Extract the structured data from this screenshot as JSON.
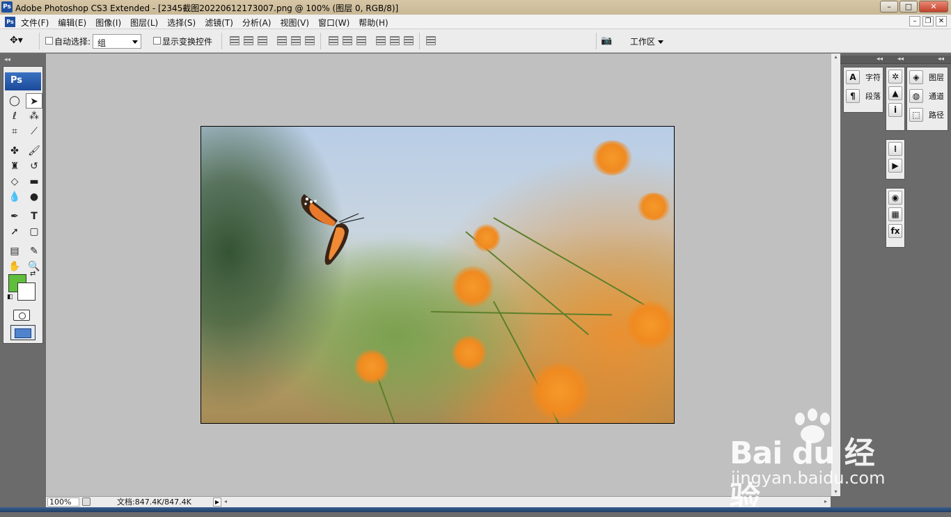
{
  "window": {
    "app_icon": "Ps",
    "title": "Adobe Photoshop CS3 Extended - [2345截图20220612173007.png @ 100% (图层 0, RGB/8)]",
    "controls": {
      "minimize": "–",
      "maximize": "□",
      "close": "✕"
    }
  },
  "menubar": {
    "items": [
      "文件(F)",
      "编辑(E)",
      "图像(I)",
      "图层(L)",
      "选择(S)",
      "滤镜(T)",
      "分析(A)",
      "视图(V)",
      "窗口(W)",
      "帮助(H)"
    ],
    "doc_controls": [
      "–",
      "❐",
      "✕"
    ]
  },
  "options": {
    "tool_icon": "move-tool-icon",
    "auto_select_label": "自动选择:",
    "auto_select_checked": false,
    "auto_select_value": "组",
    "show_transform_label": "显示变换控件",
    "show_transform_checked": false,
    "workspace_label": "工作区"
  },
  "toolbox": {
    "header": "Ps",
    "foreground_color": "#5fbe3c",
    "background_color": "#ffffff"
  },
  "document": {
    "filename": "2345截图20220612173007.png",
    "zoom": "100%",
    "doc_info": "文档:847.4K/847.4K"
  },
  "panels": {
    "col1": [
      {
        "icon": "A",
        "label": "字符"
      },
      {
        "icon": "¶",
        "label": "段落"
      }
    ],
    "col3": [
      {
        "icon": "layers-icon",
        "label": "图层"
      },
      {
        "icon": "channels-icon",
        "label": "通道"
      },
      {
        "icon": "paths-icon",
        "label": "路径"
      }
    ]
  },
  "watermark": {
    "brand": "Bai du 经验",
    "url": "jingyan.baidu.com"
  }
}
